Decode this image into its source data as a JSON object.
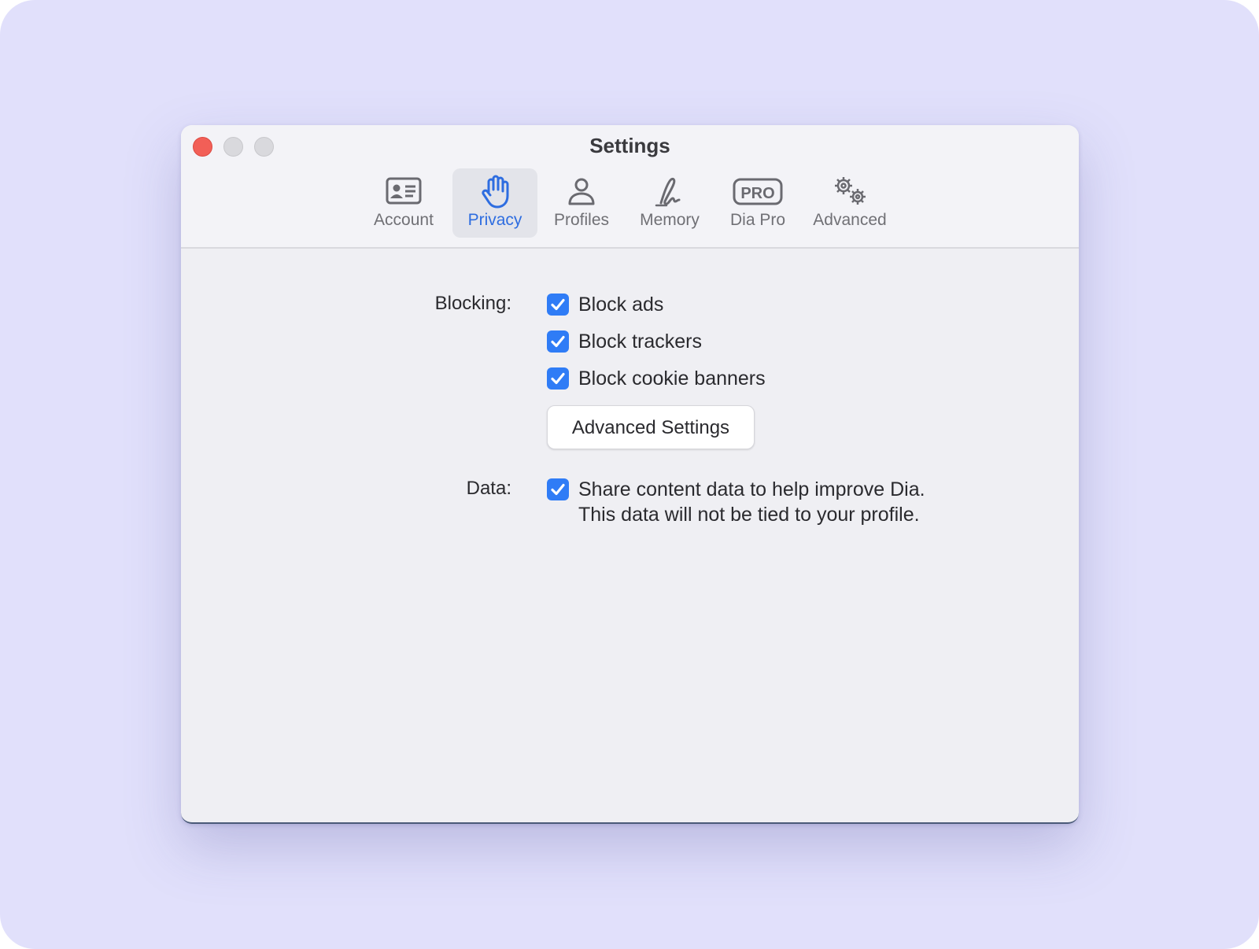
{
  "window": {
    "title": "Settings"
  },
  "tabs": [
    {
      "label": "Account",
      "icon": "contact-card-icon"
    },
    {
      "label": "Privacy",
      "icon": "hand-raised-icon",
      "selected": true
    },
    {
      "label": "Profiles",
      "icon": "person-icon"
    },
    {
      "label": "Memory",
      "icon": "signature-icon"
    },
    {
      "label": "Dia Pro",
      "icon": "pro-badge-icon"
    },
    {
      "label": "Advanced",
      "icon": "gears-icon"
    }
  ],
  "blocking": {
    "label": "Blocking:",
    "options": [
      {
        "label": "Block ads",
        "checked": true
      },
      {
        "label": "Block trackers",
        "checked": true
      },
      {
        "label": "Block cookie banners",
        "checked": true
      }
    ],
    "advanced_button": "Advanced Settings"
  },
  "data_section": {
    "label": "Data:",
    "option": {
      "label": "Share content data to help improve Dia.",
      "sublabel": "This data will not be tied to your profile.",
      "checked": true
    }
  },
  "pro_badge_text": "PRO",
  "colors": {
    "accent": "#2f7cf6",
    "selected_tab_text": "#2e6de0",
    "close_button": "#f25f57",
    "backdrop": "#e1e0fb"
  }
}
